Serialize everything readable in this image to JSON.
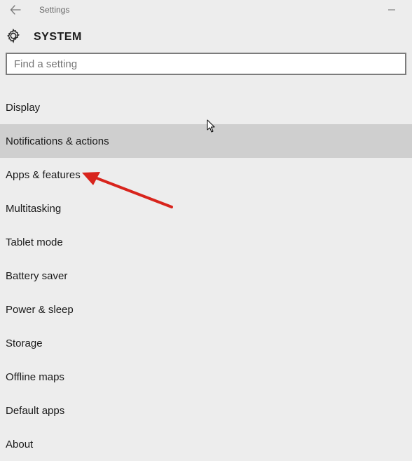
{
  "titlebar": {
    "title": "Settings"
  },
  "header": {
    "title": "SYSTEM"
  },
  "search": {
    "placeholder": "Find a setting"
  },
  "nav": {
    "items": [
      {
        "label": "Display",
        "hovered": false
      },
      {
        "label": "Notifications & actions",
        "hovered": true
      },
      {
        "label": "Apps & features",
        "hovered": false
      },
      {
        "label": "Multitasking",
        "hovered": false
      },
      {
        "label": "Tablet mode",
        "hovered": false
      },
      {
        "label": "Battery saver",
        "hovered": false
      },
      {
        "label": "Power & sleep",
        "hovered": false
      },
      {
        "label": "Storage",
        "hovered": false
      },
      {
        "label": "Offline maps",
        "hovered": false
      },
      {
        "label": "Default apps",
        "hovered": false
      },
      {
        "label": "About",
        "hovered": false
      }
    ]
  },
  "annotations": {
    "arrow_target": "Apps & features"
  }
}
